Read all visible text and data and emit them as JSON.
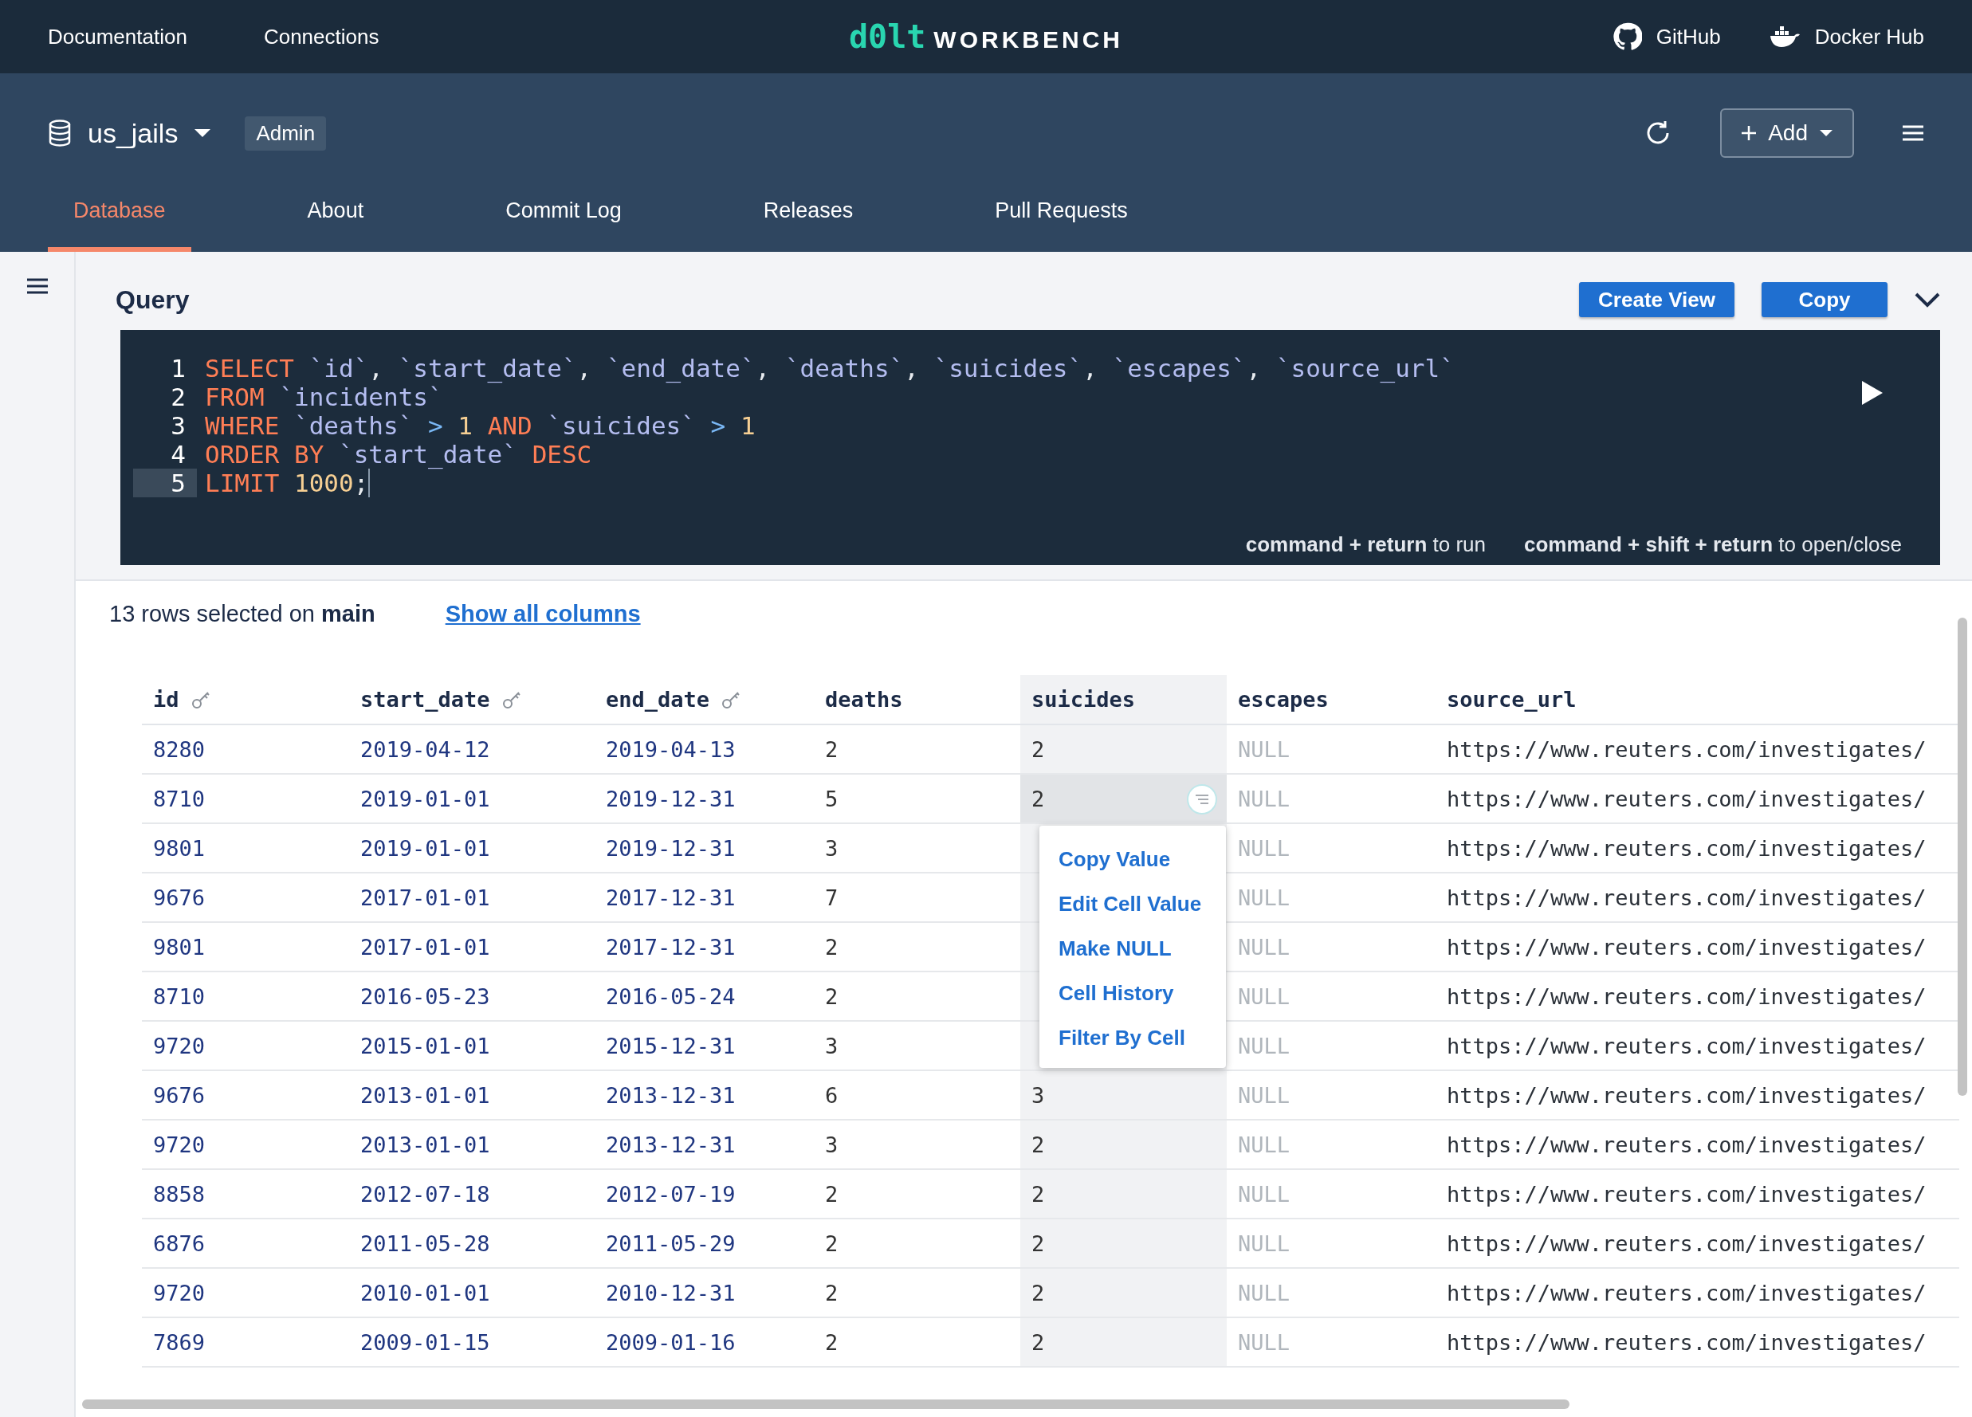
{
  "top_nav": {
    "links": [
      "Documentation",
      "Connections"
    ],
    "logo": {
      "mark": "d0lt",
      "word": "WORKBENCH"
    },
    "external": [
      {
        "kind": "github",
        "label": "GitHub"
      },
      {
        "kind": "docker",
        "label": "Docker Hub"
      }
    ]
  },
  "database": {
    "name": "us_jails",
    "role": "Admin",
    "add_button": "Add"
  },
  "tabs": [
    {
      "label": "Database",
      "selected": true
    },
    {
      "label": "About",
      "selected": false
    },
    {
      "label": "Commit Log",
      "selected": false
    },
    {
      "label": "Releases",
      "selected": false
    },
    {
      "label": "Pull Requests",
      "selected": false
    }
  ],
  "query": {
    "title": "Query",
    "buttons": [
      "Create View",
      "Copy"
    ],
    "lines": [
      {
        "number": "1",
        "current": false,
        "tokens": [
          {
            "kind": "keyword",
            "text": "SELECT "
          },
          {
            "kind": "ident",
            "text": "`id`"
          },
          {
            "kind": "plain",
            "text": ", "
          },
          {
            "kind": "ident",
            "text": "`start_date`"
          },
          {
            "kind": "plain",
            "text": ", "
          },
          {
            "kind": "ident",
            "text": "`end_date`"
          },
          {
            "kind": "plain",
            "text": ", "
          },
          {
            "kind": "ident",
            "text": "`deaths`"
          },
          {
            "kind": "plain",
            "text": ", "
          },
          {
            "kind": "ident",
            "text": "`suicides`"
          },
          {
            "kind": "plain",
            "text": ", "
          },
          {
            "kind": "ident",
            "text": "`escapes`"
          },
          {
            "kind": "plain",
            "text": ", "
          },
          {
            "kind": "ident",
            "text": "`source_url`"
          }
        ]
      },
      {
        "number": "2",
        "current": false,
        "tokens": [
          {
            "kind": "keyword",
            "text": "FROM "
          },
          {
            "kind": "ident",
            "text": "`incidents`"
          }
        ]
      },
      {
        "number": "3",
        "current": false,
        "tokens": [
          {
            "kind": "keyword",
            "text": "WHERE "
          },
          {
            "kind": "ident",
            "text": "`deaths` "
          },
          {
            "kind": "operator",
            "text": "> "
          },
          {
            "kind": "number",
            "text": "1 "
          },
          {
            "kind": "keyword",
            "text": "AND "
          },
          {
            "kind": "ident",
            "text": "`suicides` "
          },
          {
            "kind": "operator",
            "text": "> "
          },
          {
            "kind": "number",
            "text": "1"
          }
        ]
      },
      {
        "number": "4",
        "current": false,
        "tokens": [
          {
            "kind": "keyword",
            "text": "ORDER BY "
          },
          {
            "kind": "ident",
            "text": "`start_date` "
          },
          {
            "kind": "keyword",
            "text": "DESC"
          }
        ]
      },
      {
        "number": "5",
        "current": true,
        "tokens": [
          {
            "kind": "keyword",
            "text": "LIMIT "
          },
          {
            "kind": "number",
            "text": "1000"
          },
          {
            "kind": "plain",
            "text": ";"
          }
        ]
      }
    ],
    "hints": [
      "**command + return** to run",
      "**command + shift + return** to open/close"
    ]
  },
  "results": {
    "summary": "13 rows selected on **main**",
    "show_all_link": "Show all columns",
    "columns": [
      {
        "name": "id",
        "key": true,
        "selected": false
      },
      {
        "name": "start_date",
        "key": true,
        "selected": false
      },
      {
        "name": "end_date",
        "key": true,
        "selected": false
      },
      {
        "name": "deaths",
        "key": false,
        "selected": false
      },
      {
        "name": "suicides",
        "key": false,
        "selected": true
      },
      {
        "name": "escapes",
        "key": false,
        "selected": false
      },
      {
        "name": "source_url",
        "key": false,
        "selected": false
      }
    ],
    "rows": [
      {
        "selected": false,
        "cells": [
          "8280",
          "2019-04-12",
          "2019-04-13",
          "2",
          "2",
          "NULL",
          "https://www.reuters.com/investigates/"
        ]
      },
      {
        "selected": true,
        "cells": [
          "8710",
          "2019-01-01",
          "2019-12-31",
          "5",
          "2",
          "NULL",
          "https://www.reuters.com/investigates/"
        ]
      },
      {
        "selected": false,
        "cells": [
          "9801",
          "2019-01-01",
          "2019-12-31",
          "3",
          null,
          "NULL",
          "https://www.reuters.com/investigates/"
        ]
      },
      {
        "selected": false,
        "cells": [
          "9676",
          "2017-01-01",
          "2017-12-31",
          "7",
          null,
          "NULL",
          "https://www.reuters.com/investigates/"
        ]
      },
      {
        "selected": false,
        "cells": [
          "9801",
          "2017-01-01",
          "2017-12-31",
          "2",
          null,
          "NULL",
          "https://www.reuters.com/investigates/"
        ]
      },
      {
        "selected": false,
        "cells": [
          "8710",
          "2016-05-23",
          "2016-05-24",
          "2",
          null,
          "NULL",
          "https://www.reuters.com/investigates/"
        ]
      },
      {
        "selected": false,
        "cells": [
          "9720",
          "2015-01-01",
          "2015-12-31",
          "3",
          null,
          "NULL",
          "https://www.reuters.com/investigates/"
        ]
      },
      {
        "selected": false,
        "cells": [
          "9676",
          "2013-01-01",
          "2013-12-31",
          "6",
          "3",
          "NULL",
          "https://www.reuters.com/investigates/"
        ]
      },
      {
        "selected": false,
        "cells": [
          "9720",
          "2013-01-01",
          "2013-12-31",
          "3",
          "2",
          "NULL",
          "https://www.reuters.com/investigates/"
        ]
      },
      {
        "selected": false,
        "cells": [
          "8858",
          "2012-07-18",
          "2012-07-19",
          "2",
          "2",
          "NULL",
          "https://www.reuters.com/investigates/"
        ]
      },
      {
        "selected": false,
        "cells": [
          "6876",
          "2011-05-28",
          "2011-05-29",
          "2",
          "2",
          "NULL",
          "https://www.reuters.com/investigates/"
        ]
      },
      {
        "selected": false,
        "cells": [
          "9720",
          "2010-01-01",
          "2010-12-31",
          "2",
          "2",
          "NULL",
          "https://www.reuters.com/investigates/"
        ]
      },
      {
        "selected": false,
        "cells": [
          "7869",
          "2009-01-15",
          "2009-01-16",
          "2",
          "2",
          "NULL",
          "https://www.reuters.com/investigates/"
        ]
      }
    ],
    "cell_menu": [
      "Copy Value",
      "Edit Cell Value",
      "Make NULL",
      "Cell History",
      "Filter By Cell"
    ]
  }
}
